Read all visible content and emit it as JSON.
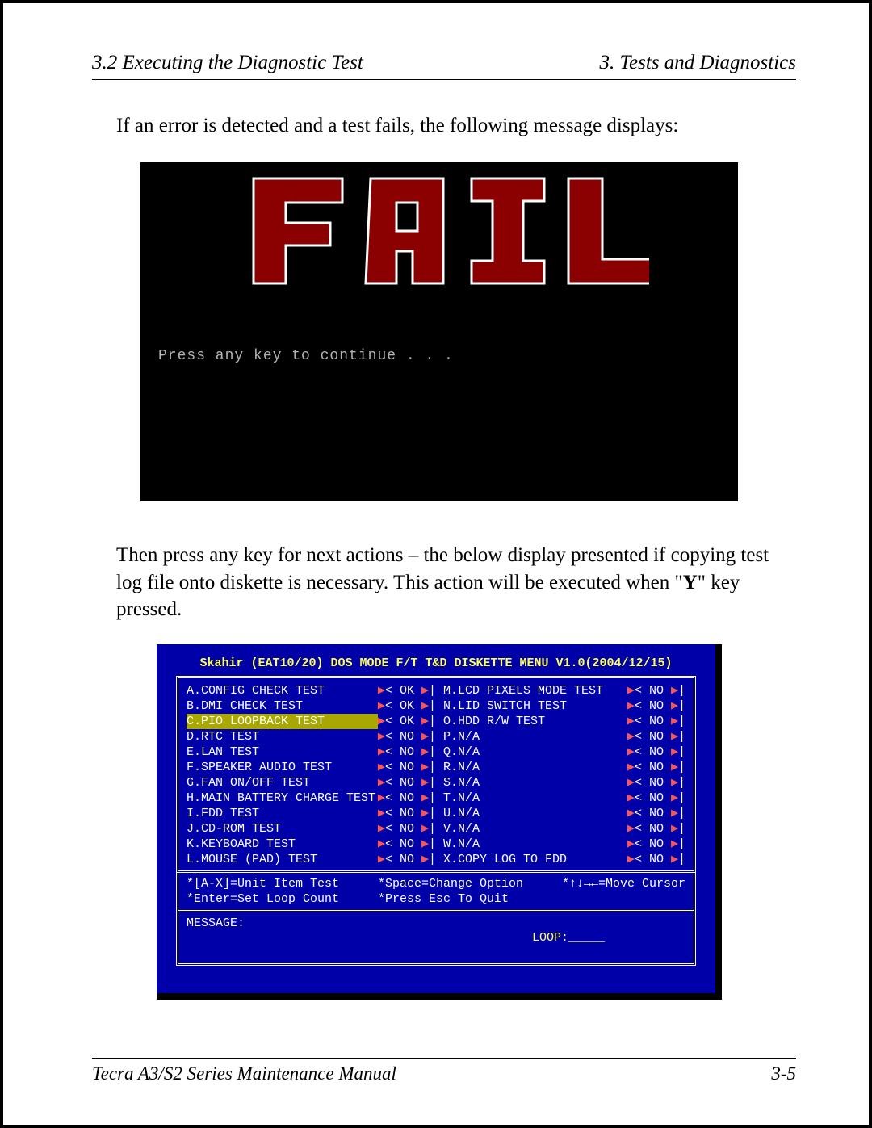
{
  "header": {
    "left": "3.2  Executing the Diagnostic Test",
    "right": "3.  Tests and Diagnostics"
  },
  "para1": "If an error is detected and a test fails, the following message displays:",
  "fail": {
    "press": "Press any key to continue . . ."
  },
  "para2_a": "Then press any key for next actions – the below display presented if copying test log file onto diskette is necessary. This action will be executed when \"",
  "para2_y": "Y",
  "para2_b": "\" key pressed.",
  "menu": {
    "title": "Skahir (EAT10/20) DOS MODE F/T T&D DISKETTE MENU V1.0(2004/12/15)",
    "left_tests": [
      {
        "l": "A.CONFIG CHECK TEST",
        "s": "OK",
        "hl": false
      },
      {
        "l": "B.DMI CHECK TEST",
        "s": "OK",
        "hl": false
      },
      {
        "l": "C.PIO LOOPBACK TEST",
        "s": "OK",
        "hl": true
      },
      {
        "l": "D.RTC TEST",
        "s": "NO",
        "hl": false
      },
      {
        "l": "E.LAN TEST",
        "s": "NO",
        "hl": false
      },
      {
        "l": "F.SPEAKER AUDIO TEST",
        "s": "NO",
        "hl": false
      },
      {
        "l": "G.FAN ON/OFF TEST",
        "s": "NO",
        "hl": false
      },
      {
        "l": "H.MAIN BATTERY CHARGE TEST",
        "s": "NO",
        "hl": false
      },
      {
        "l": "I.FDD TEST",
        "s": "NO",
        "hl": false
      },
      {
        "l": "J.CD-ROM TEST",
        "s": "NO",
        "hl": false
      },
      {
        "l": "K.KEYBOARD TEST",
        "s": "NO",
        "hl": false
      },
      {
        "l": "L.MOUSE (PAD) TEST",
        "s": "NO",
        "hl": false
      }
    ],
    "right_tests": [
      {
        "l": "M.LCD PIXELS MODE TEST",
        "s": "NO"
      },
      {
        "l": "N.LID SWITCH TEST",
        "s": "NO"
      },
      {
        "l": "O.HDD R/W TEST",
        "s": "NO"
      },
      {
        "l": "P.N/A",
        "s": "NO"
      },
      {
        "l": "Q.N/A",
        "s": "NO"
      },
      {
        "l": "R.N/A",
        "s": "NO"
      },
      {
        "l": "S.N/A",
        "s": "NO"
      },
      {
        "l": "T.N/A",
        "s": "NO"
      },
      {
        "l": "U.N/A",
        "s": "NO"
      },
      {
        "l": "V.N/A",
        "s": "NO"
      },
      {
        "l": "W.N/A",
        "s": "NO"
      },
      {
        "l": "X.COPY LOG TO FDD",
        "s": "NO"
      }
    ],
    "help": {
      "c1a": "*[A-X]=Unit Item Test",
      "c1b": "*Enter=Set Loop Count",
      "c2a": "*Space=Change Option",
      "c2b": "*Press Esc To Quit",
      "c3": "*↑↓→←=Move Cursor"
    },
    "message_label": "MESSAGE:",
    "loop_label": "LOOP:_____"
  },
  "footer": {
    "left": "Tecra A3/S2 Series Maintenance Manual",
    "right": "3-5"
  }
}
